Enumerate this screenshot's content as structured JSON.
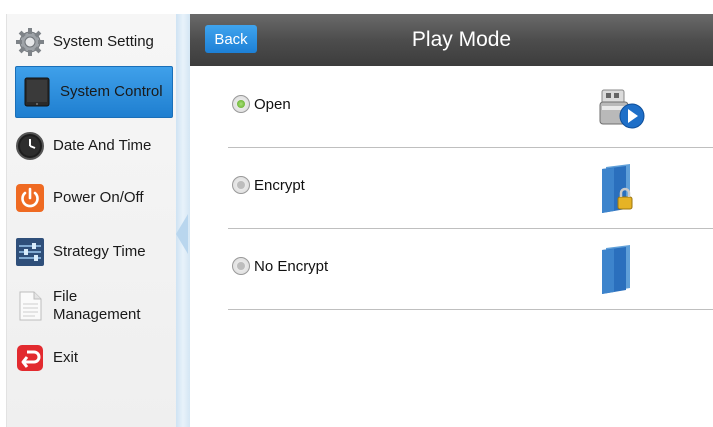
{
  "sidebar": {
    "items": [
      {
        "label": "System Setting",
        "icon": "gear-icon"
      },
      {
        "label": "System Control",
        "icon": "tablet-icon"
      },
      {
        "label": "Date And Time",
        "icon": "clock-icon"
      },
      {
        "label": "Power On/Off",
        "icon": "power-icon"
      },
      {
        "label": "Strategy Time",
        "icon": "sliders-icon"
      },
      {
        "label": "File Management",
        "icon": "document-icon"
      },
      {
        "label": "Exit",
        "icon": "exit-icon"
      }
    ],
    "active_index": 1
  },
  "header": {
    "back_label": "Back",
    "title": "Play Mode"
  },
  "options": [
    {
      "label": "Open",
      "selected": true,
      "icon": "usb-play-icon"
    },
    {
      "label": "Encrypt",
      "selected": false,
      "icon": "locked-folder-icon"
    },
    {
      "label": "No Encrypt",
      "selected": false,
      "icon": "folder-icon"
    }
  ],
  "colors": {
    "accent": "#2588dc",
    "header": "#4d4d4d",
    "selected_radio": "#6cc02a"
  }
}
